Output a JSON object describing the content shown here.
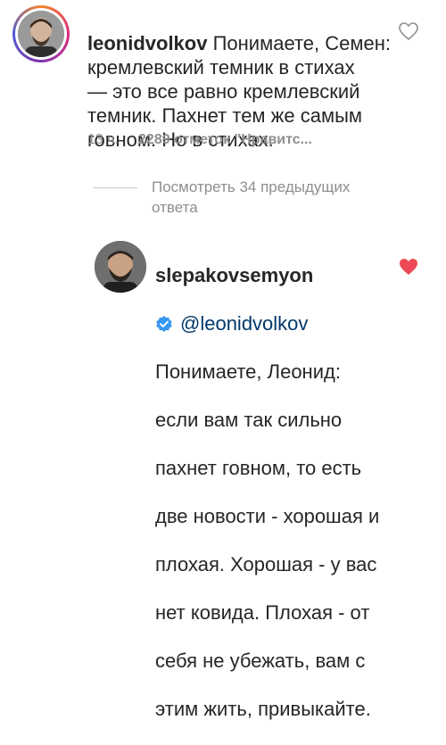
{
  "parent_comment": {
    "username": "leonidvolkov",
    "text": "Понимаете, Семен:\nкремлевский темник в стихах\n— это все равно кремлевский\nтемник. Пахнет тем же самым\nговном. Но в стихах.",
    "time": "13 ч.",
    "likes": "2289 отметок \"Нравитс...",
    "liked": false
  },
  "view_replies": {
    "label": "Посмотреть 34 предыдущих ответа"
  },
  "reply": {
    "username": "slepakovsemyon",
    "verified": true,
    "mention": "@leonidvolkov",
    "lines": [
      "Понимаете, Леонид:",
      "если вам так сильно",
      "пахнет говном, то есть",
      "две новости - хорошая и",
      "плохая. Хорошая - у вас",
      "нет ковида. Плохая - от",
      "себя не убежать, вам с",
      "этим жить, привыкайте."
    ],
    "liked": true,
    "heart_color": "#ed4956"
  },
  "colors": {
    "text": "#262626",
    "muted": "#8e8e8e",
    "verified": "#3897f0"
  },
  "icons": {
    "like_outline": "heart-outline-icon",
    "like_filled": "heart-filled-icon",
    "verified": "verified-badge-icon"
  }
}
